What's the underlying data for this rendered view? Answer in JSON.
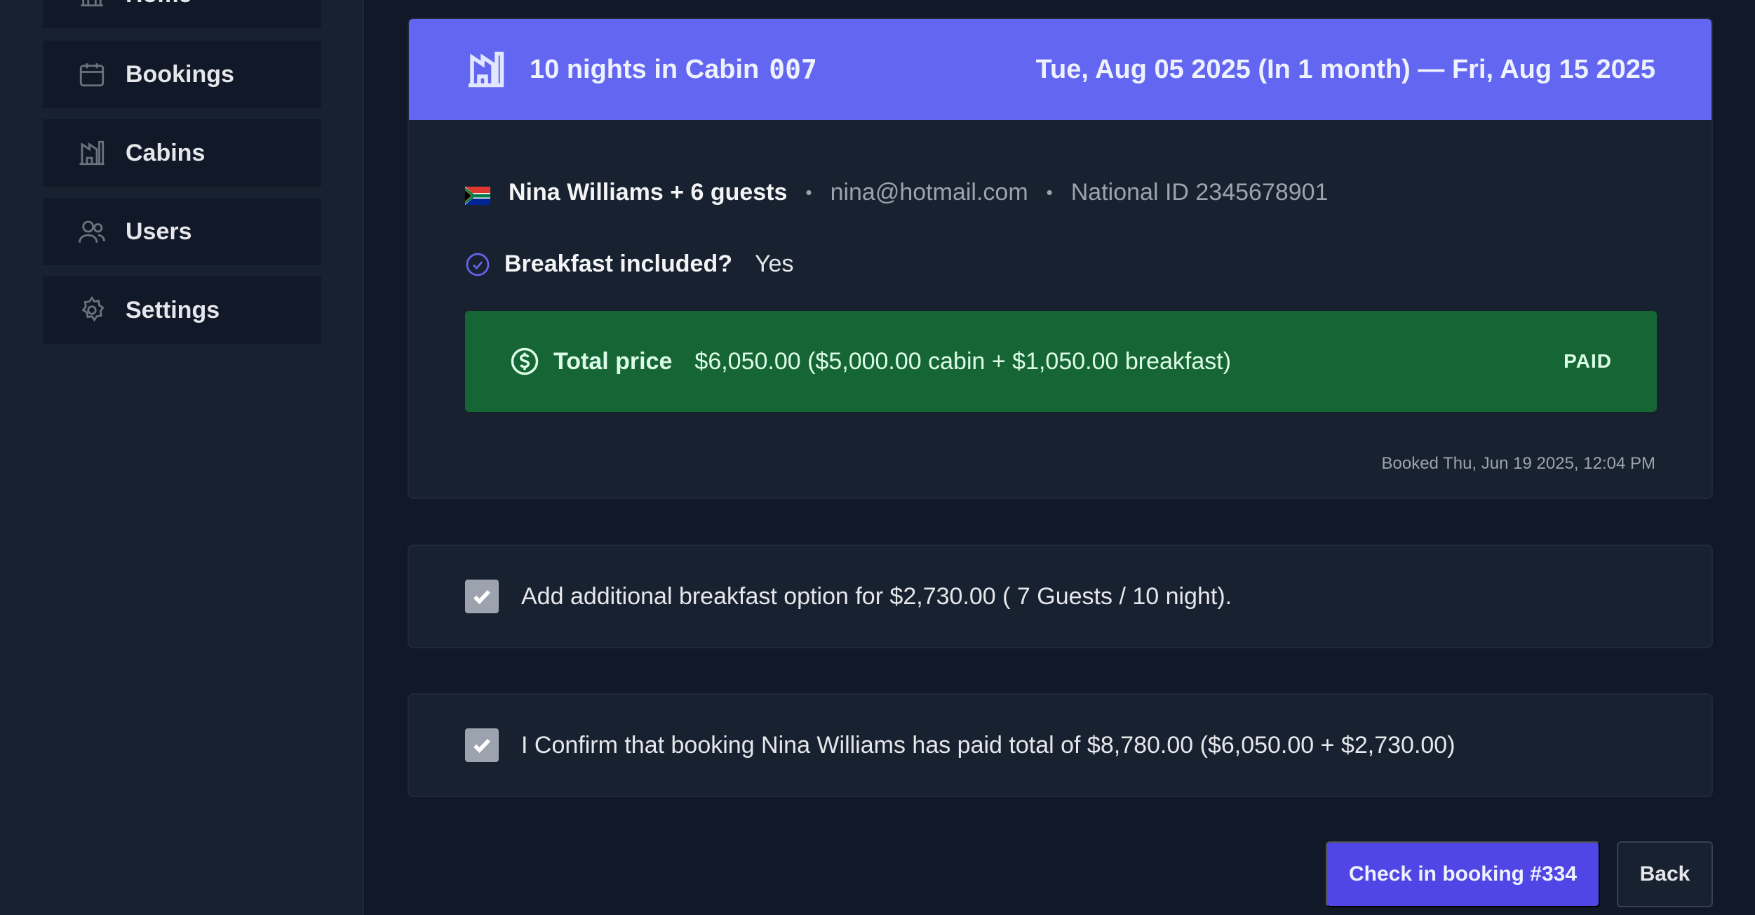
{
  "sidebar": {
    "items": [
      {
        "label": "Home",
        "icon": "home-icon"
      },
      {
        "label": "Bookings",
        "icon": "calendar-icon"
      },
      {
        "label": "Cabins",
        "icon": "cabin-icon"
      },
      {
        "label": "Users",
        "icon": "users-icon"
      },
      {
        "label": "Settings",
        "icon": "gear-icon"
      }
    ]
  },
  "booking": {
    "header": {
      "title": "10 nights in Cabin",
      "cabin_number": "007",
      "dates": "Tue, Aug 05 2025 (In 1 month) — Fri, Aug 15 2025",
      "color": "#6366f1"
    },
    "guest": {
      "name": "Nina Williams + 6 guests",
      "email": "nina@hotmail.com",
      "national_id": "National ID 2345678901",
      "flag_icon": "south-africa-flag-icon"
    },
    "breakfast": {
      "label": "Breakfast included?",
      "value": "Yes"
    },
    "price": {
      "label": "Total price",
      "value": "$6,050.00 ($5,000.00 cabin + $1,050.00 breakfast)",
      "status": "PAID",
      "color": "#166534"
    },
    "booked_at": "Booked Thu, Jun 19 2025, 12:04 PM"
  },
  "options": {
    "add_breakfast": {
      "text": "Add additional breakfast option for $2,730.00 ( 7 Guests / 10 night).",
      "checked": true
    },
    "confirm_paid": {
      "text": "I Confirm that booking Nina Williams has paid total of $8,780.00 ($6,050.00 + $2,730.00)",
      "checked": true
    }
  },
  "actions": {
    "checkin_label": "Check in booking #334",
    "back_label": "Back"
  }
}
